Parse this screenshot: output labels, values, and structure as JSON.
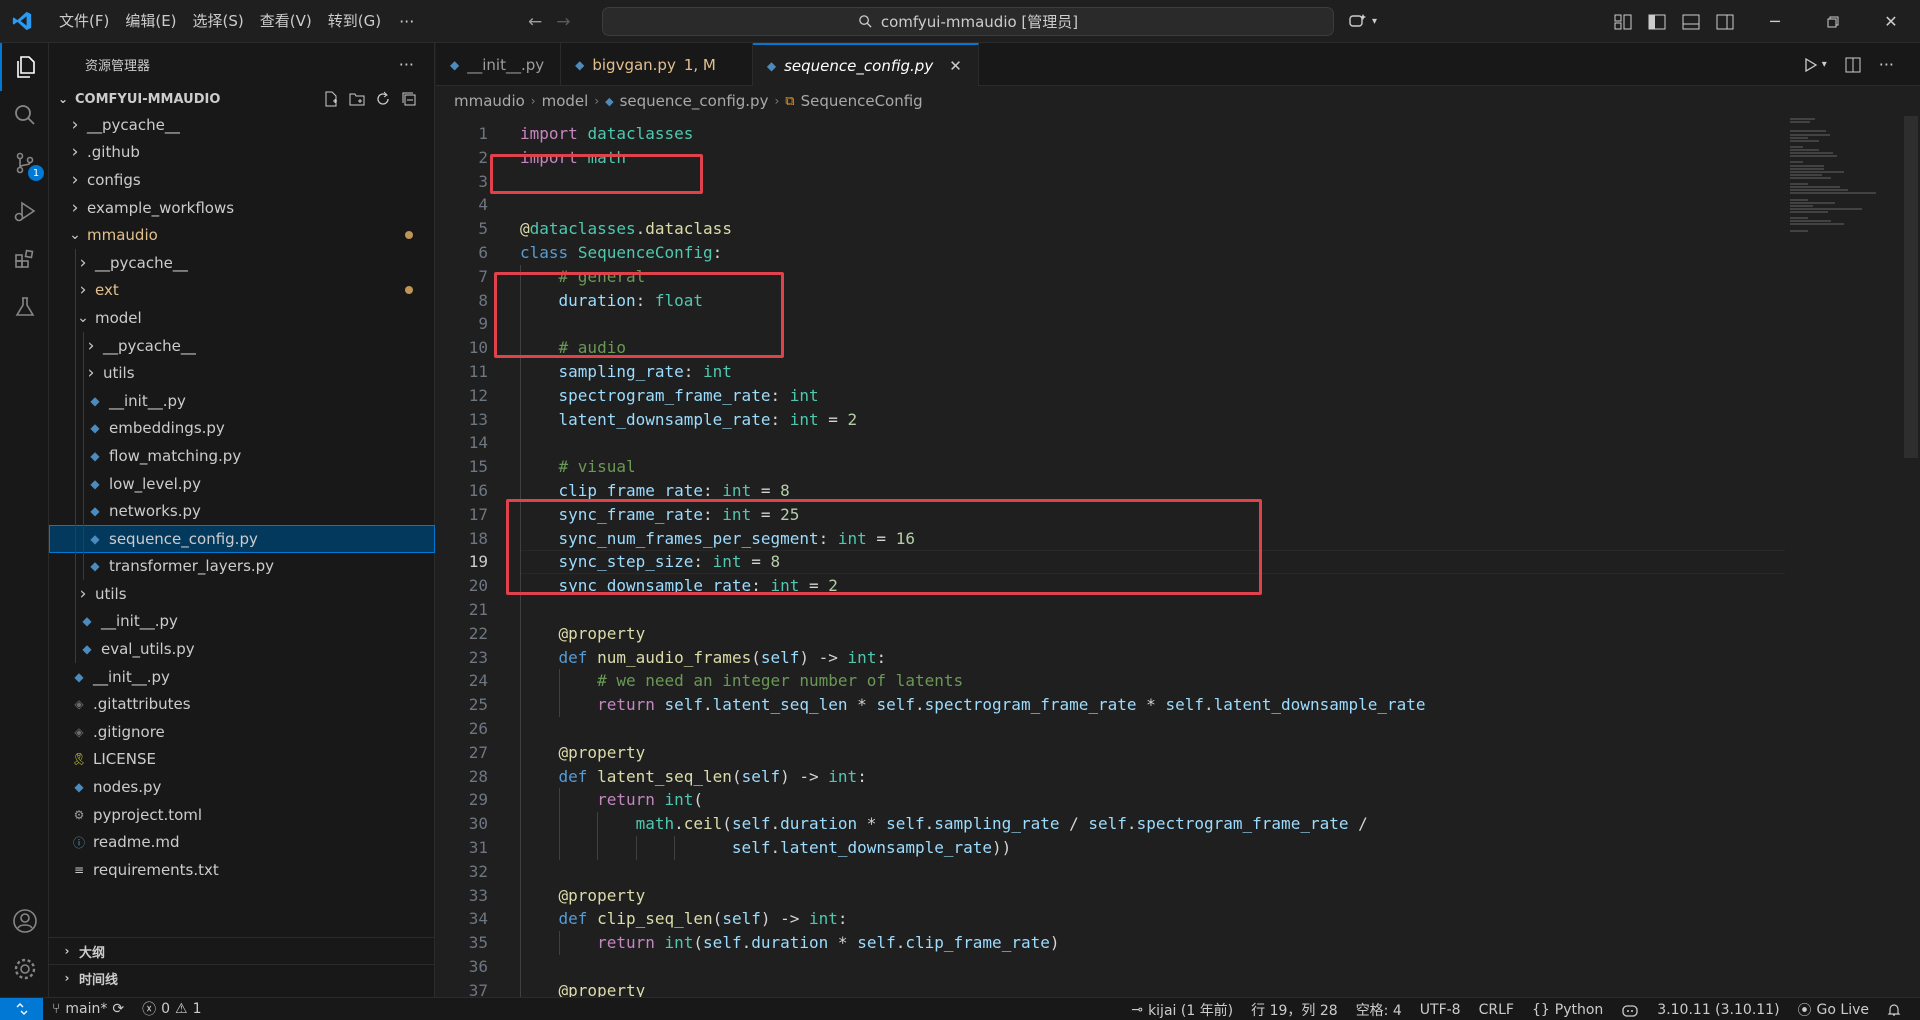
{
  "titlebar": {
    "menu": [
      "文件(F)",
      "编辑(E)",
      "选择(S)",
      "查看(V)",
      "转到(G)"
    ],
    "more": "···",
    "command_center": "comfyui-mmaudio [管理员]"
  },
  "activity": {
    "scm_badge": "1"
  },
  "sidebar": {
    "title": "资源管理器",
    "more": "···",
    "project": "COMFYUI-MMAUDIO",
    "tree": [
      {
        "label": "__pycache__",
        "depth": 1,
        "kind": "folder",
        "open": false
      },
      {
        "label": ".github",
        "depth": 1,
        "kind": "folder",
        "open": false
      },
      {
        "label": "configs",
        "depth": 1,
        "kind": "folder",
        "open": false
      },
      {
        "label": "example_workflows",
        "depth": 1,
        "kind": "folder",
        "open": false
      },
      {
        "label": "mmaudio",
        "depth": 1,
        "kind": "folder",
        "open": true,
        "modified": true
      },
      {
        "label": "__pycache__",
        "depth": 2,
        "kind": "folder",
        "open": false
      },
      {
        "label": "ext",
        "depth": 2,
        "kind": "folder",
        "open": false,
        "modified": true
      },
      {
        "label": "model",
        "depth": 2,
        "kind": "folder",
        "open": true
      },
      {
        "label": "__pycache__",
        "depth": 3,
        "kind": "folder",
        "open": false
      },
      {
        "label": "utils",
        "depth": 3,
        "kind": "folder",
        "open": false
      },
      {
        "label": "__init__.py",
        "depth": 3,
        "kind": "py"
      },
      {
        "label": "embeddings.py",
        "depth": 3,
        "kind": "py"
      },
      {
        "label": "flow_matching.py",
        "depth": 3,
        "kind": "py"
      },
      {
        "label": "low_level.py",
        "depth": 3,
        "kind": "py"
      },
      {
        "label": "networks.py",
        "depth": 3,
        "kind": "py"
      },
      {
        "label": "sequence_config.py",
        "depth": 3,
        "kind": "py",
        "selected": true
      },
      {
        "label": "transformer_layers.py",
        "depth": 3,
        "kind": "py"
      },
      {
        "label": "utils",
        "depth": 2,
        "kind": "folder",
        "open": false
      },
      {
        "label": "__init__.py",
        "depth": 2,
        "kind": "py"
      },
      {
        "label": "eval_utils.py",
        "depth": 2,
        "kind": "py"
      },
      {
        "label": "__init__.py",
        "depth": 1,
        "kind": "py"
      },
      {
        "label": ".gitattributes",
        "depth": 1,
        "kind": "git"
      },
      {
        "label": ".gitignore",
        "depth": 1,
        "kind": "git"
      },
      {
        "label": "LICENSE",
        "depth": 1,
        "kind": "license"
      },
      {
        "label": "nodes.py",
        "depth": 1,
        "kind": "py"
      },
      {
        "label": "pyproject.toml",
        "depth": 1,
        "kind": "toml"
      },
      {
        "label": "readme.md",
        "depth": 1,
        "kind": "md"
      },
      {
        "label": "requirements.txt",
        "depth": 1,
        "kind": "txt"
      }
    ],
    "outline_label": "大纲",
    "timeline_label": "时间线"
  },
  "tabs": [
    {
      "label": "__init__.py",
      "suffix": "",
      "active": false
    },
    {
      "label": "bigvgan.py",
      "suffix": "1, M",
      "active": false
    },
    {
      "label": "sequence_config.py",
      "suffix": "",
      "active": true
    }
  ],
  "breadcrumb": [
    "mmaudio",
    "model",
    "sequence_config.py",
    "SequenceConfig"
  ],
  "editor": {
    "current_line": 19,
    "lines": [
      [
        [
          "kw-i",
          "import"
        ],
        [
          "op",
          " "
        ],
        [
          "mod-n",
          "dataclasses"
        ]
      ],
      [
        [
          "kw-i",
          "import"
        ],
        [
          "op",
          " "
        ],
        [
          "mod-n",
          "math"
        ]
      ],
      [],
      [],
      [
        [
          "deco",
          "@"
        ],
        [
          "mod-n",
          "dataclasses"
        ],
        [
          "op",
          "."
        ],
        [
          "deco",
          "dataclass"
        ]
      ],
      [
        [
          "kw",
          "class"
        ],
        [
          "op",
          " "
        ],
        [
          "cls",
          "SequenceConfig"
        ],
        [
          "op",
          ":"
        ]
      ],
      [
        [
          "op",
          "    "
        ],
        [
          "cmt",
          "# general"
        ]
      ],
      [
        [
          "op",
          "    "
        ],
        [
          "var",
          "duration"
        ],
        [
          "op",
          ": "
        ],
        [
          "ty",
          "float"
        ]
      ],
      [],
      [
        [
          "op",
          "    "
        ],
        [
          "cmt",
          "# audio"
        ]
      ],
      [
        [
          "op",
          "    "
        ],
        [
          "var",
          "sampling_rate"
        ],
        [
          "op",
          ": "
        ],
        [
          "ty",
          "int"
        ]
      ],
      [
        [
          "op",
          "    "
        ],
        [
          "var",
          "spectrogram_frame_rate"
        ],
        [
          "op",
          ": "
        ],
        [
          "ty",
          "int"
        ]
      ],
      [
        [
          "op",
          "    "
        ],
        [
          "var",
          "latent_downsample_rate"
        ],
        [
          "op",
          ": "
        ],
        [
          "ty",
          "int"
        ],
        [
          "op",
          " = "
        ],
        [
          "num",
          "2"
        ]
      ],
      [],
      [
        [
          "op",
          "    "
        ],
        [
          "cmt",
          "# visual"
        ]
      ],
      [
        [
          "op",
          "    "
        ],
        [
          "var",
          "clip_frame_rate"
        ],
        [
          "op",
          ": "
        ],
        [
          "ty",
          "int"
        ],
        [
          "op",
          " = "
        ],
        [
          "num",
          "8"
        ]
      ],
      [
        [
          "op",
          "    "
        ],
        [
          "var",
          "sync_frame_rate"
        ],
        [
          "op",
          ": "
        ],
        [
          "ty",
          "int"
        ],
        [
          "op",
          " = "
        ],
        [
          "num",
          "25"
        ]
      ],
      [
        [
          "op",
          "    "
        ],
        [
          "var",
          "sync_num_frames_per_segment"
        ],
        [
          "op",
          ": "
        ],
        [
          "ty",
          "int"
        ],
        [
          "op",
          " = "
        ],
        [
          "num",
          "16"
        ]
      ],
      [
        [
          "op",
          "    "
        ],
        [
          "var",
          "sync_step_size"
        ],
        [
          "op",
          ": "
        ],
        [
          "ty",
          "int"
        ],
        [
          "op",
          " = "
        ],
        [
          "num",
          "8"
        ]
      ],
      [
        [
          "op",
          "    "
        ],
        [
          "var",
          "sync_downsample_rate"
        ],
        [
          "op",
          ": "
        ],
        [
          "ty",
          "int"
        ],
        [
          "op",
          " = "
        ],
        [
          "num",
          "2"
        ]
      ],
      [],
      [
        [
          "op",
          "    "
        ],
        [
          "deco",
          "@property"
        ]
      ],
      [
        [
          "op",
          "    "
        ],
        [
          "kw",
          "def"
        ],
        [
          "op",
          " "
        ],
        [
          "fn",
          "num_audio_frames"
        ],
        [
          "op",
          "("
        ],
        [
          "var",
          "self"
        ],
        [
          "op",
          ") -> "
        ],
        [
          "ty",
          "int"
        ],
        [
          "op",
          ":"
        ]
      ],
      [
        [
          "op",
          "        "
        ],
        [
          "cmt",
          "# we need an integer number of latents"
        ]
      ],
      [
        [
          "op",
          "        "
        ],
        [
          "kw-i",
          "return"
        ],
        [
          "op",
          " "
        ],
        [
          "var",
          "self"
        ],
        [
          "op",
          "."
        ],
        [
          "var",
          "latent_seq_len"
        ],
        [
          "op",
          " * "
        ],
        [
          "var",
          "self"
        ],
        [
          "op",
          "."
        ],
        [
          "var",
          "spectrogram_frame_rate"
        ],
        [
          "op",
          " * "
        ],
        [
          "var",
          "self"
        ],
        [
          "op",
          "."
        ],
        [
          "var",
          "latent_downsample_rate"
        ]
      ],
      [],
      [
        [
          "op",
          "    "
        ],
        [
          "deco",
          "@property"
        ]
      ],
      [
        [
          "op",
          "    "
        ],
        [
          "kw",
          "def"
        ],
        [
          "op",
          " "
        ],
        [
          "fn",
          "latent_seq_len"
        ],
        [
          "op",
          "("
        ],
        [
          "var",
          "self"
        ],
        [
          "op",
          ") -> "
        ],
        [
          "ty",
          "int"
        ],
        [
          "op",
          ":"
        ]
      ],
      [
        [
          "op",
          "        "
        ],
        [
          "kw-i",
          "return"
        ],
        [
          "op",
          " "
        ],
        [
          "ty",
          "int"
        ],
        [
          "op",
          "("
        ]
      ],
      [
        [
          "op",
          "            "
        ],
        [
          "mod-n",
          "math"
        ],
        [
          "op",
          "."
        ],
        [
          "fn",
          "ceil"
        ],
        [
          "op",
          "("
        ],
        [
          "var",
          "self"
        ],
        [
          "op",
          "."
        ],
        [
          "var",
          "duration"
        ],
        [
          "op",
          " * "
        ],
        [
          "var",
          "self"
        ],
        [
          "op",
          "."
        ],
        [
          "var",
          "sampling_rate"
        ],
        [
          "op",
          " / "
        ],
        [
          "var",
          "self"
        ],
        [
          "op",
          "."
        ],
        [
          "var",
          "spectrogram_frame_rate"
        ],
        [
          "op",
          " /"
        ]
      ],
      [
        [
          "op",
          "                      "
        ],
        [
          "var",
          "self"
        ],
        [
          "op",
          "."
        ],
        [
          "var",
          "latent_downsample_rate"
        ],
        [
          "op",
          "))"
        ]
      ],
      [],
      [
        [
          "op",
          "    "
        ],
        [
          "deco",
          "@property"
        ]
      ],
      [
        [
          "op",
          "    "
        ],
        [
          "kw",
          "def"
        ],
        [
          "op",
          " "
        ],
        [
          "fn",
          "clip_seq_len"
        ],
        [
          "op",
          "("
        ],
        [
          "var",
          "self"
        ],
        [
          "op",
          ") -> "
        ],
        [
          "ty",
          "int"
        ],
        [
          "op",
          ":"
        ]
      ],
      [
        [
          "op",
          "        "
        ],
        [
          "kw-i",
          "return"
        ],
        [
          "op",
          " "
        ],
        [
          "ty",
          "int"
        ],
        [
          "op",
          "("
        ],
        [
          "var",
          "self"
        ],
        [
          "op",
          "."
        ],
        [
          "var",
          "duration"
        ],
        [
          "op",
          " * "
        ],
        [
          "var",
          "self"
        ],
        [
          "op",
          "."
        ],
        [
          "var",
          "clip_frame_rate"
        ],
        [
          "op",
          ")"
        ]
      ],
      [],
      [
        [
          "op",
          "    "
        ],
        [
          "deco",
          "@property"
        ]
      ]
    ]
  },
  "statusbar": {
    "branch": "main*",
    "errors": "0",
    "warnings": "1",
    "blame": "kijai (1 年前)",
    "position": "行 19，列 28",
    "spaces": "空格: 4",
    "encoding": "UTF-8",
    "eol": "CRLF",
    "language": "Python",
    "interpreter": "3.10.11 (3.10.11)",
    "golive": "Go Live"
  },
  "colors": {
    "accent": "#0078d4",
    "highlight_box": "#e0424b"
  }
}
